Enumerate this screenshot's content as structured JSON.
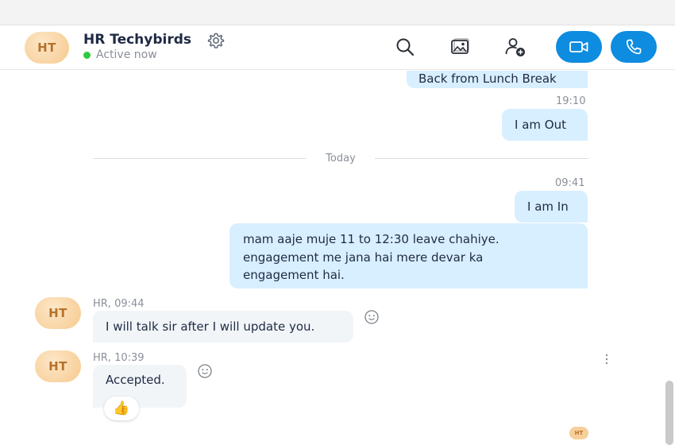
{
  "header": {
    "avatar_initials": "HT",
    "contact_name": "HR Techybirds",
    "status": "Active now",
    "status_color": "#2ecc40",
    "icons": [
      "search-icon",
      "gallery-icon",
      "add-participant-icon",
      "video-call-icon",
      "audio-call-icon"
    ]
  },
  "accent_color": "#0d8ce0",
  "messages": [
    {
      "type": "outgoing",
      "text": "Back from Lunch Break"
    },
    {
      "type": "time",
      "text": "19:10"
    },
    {
      "type": "outgoing",
      "text": "I am Out"
    },
    {
      "type": "divider",
      "text": "Today"
    },
    {
      "type": "time",
      "text": "09:41"
    },
    {
      "type": "outgoing",
      "text": "I am In"
    },
    {
      "type": "outgoing",
      "lines": [
        "mam aaje muje 11 to 12:30 leave chahiye.",
        "engagement me jana hai mere devar ka",
        "engagement hai."
      ]
    },
    {
      "type": "incoming",
      "avatar": "HT",
      "meta": "HR, 09:44",
      "text": "I will talk sir after I will update you."
    },
    {
      "type": "incoming",
      "avatar": "HT",
      "meta": "HR, 10:39",
      "text": "Accepted.",
      "reaction": "👍"
    }
  ],
  "read_receipt_avatar": "HT"
}
